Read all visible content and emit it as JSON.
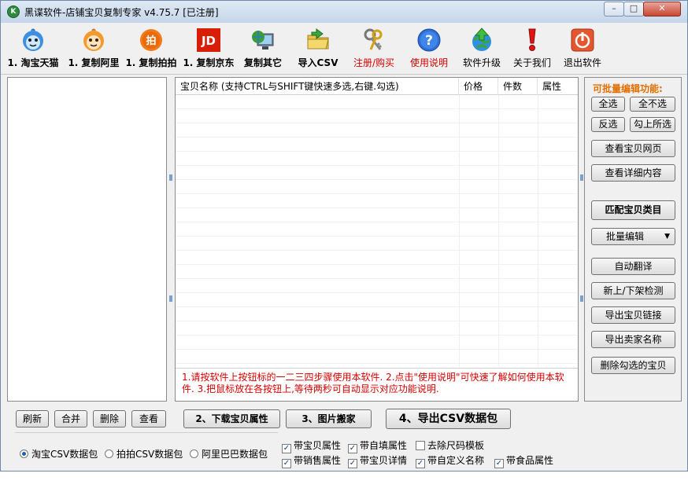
{
  "window": {
    "title": "黑谍软件-店铺宝贝复制专家  v4.75.7 [已注册]",
    "controls": {
      "minimize": "–",
      "maximize": "□",
      "close": "✕"
    }
  },
  "toolbar": [
    {
      "label": "1. 淘宝天猫",
      "icon": "taobao-mascot-icon",
      "style": "bold"
    },
    {
      "label": "1. 复制阿里",
      "icon": "ali-mascot-icon",
      "style": "bold"
    },
    {
      "label": "1. 复制拍拍",
      "icon": "paipai-icon",
      "icon_text": "拍",
      "style": "bold"
    },
    {
      "label": "1. 复制京东",
      "icon": "jd-icon",
      "icon_text": "JD",
      "style": "bold"
    },
    {
      "label": "复制其它",
      "icon": "computer-globe-icon",
      "style": "bold"
    },
    {
      "label": "导入CSV",
      "icon": "folder-import-icon",
      "style": "bold"
    },
    {
      "label": "注册/购买",
      "icon": "keys-icon",
      "style": "red"
    },
    {
      "label": "使用说明",
      "icon": "help-icon",
      "style": "red"
    },
    {
      "label": "软件升级",
      "icon": "upgrade-globe-icon",
      "style": "plain"
    },
    {
      "label": "关于我们",
      "icon": "exclamation-icon",
      "style": "plain"
    },
    {
      "label": "退出软件",
      "icon": "power-icon",
      "style": "plain"
    }
  ],
  "list": {
    "columns": [
      "宝贝名称 (支持CTRL与SHIFT键快速多选,右键.勾选)",
      "价格",
      "件数",
      "属性"
    ],
    "rows": []
  },
  "note": "1.请按软件上按钮标的一二三四步骤使用本软件. 2.点击\"使用说明\"可快速了解如何使用本软件. 3.把鼠标放在各按钮上,等待两秒可自动显示对应功能说明.",
  "right_panel": {
    "title": "可批量编辑功能:",
    "select_all": "全选",
    "select_none": "全不选",
    "invert": "反选",
    "check_selected": "勾上所选",
    "view_page": "查看宝贝网页",
    "view_detail": "查看详细内容",
    "match_category": "匹配宝贝类目",
    "batch_edit": "批量编辑",
    "auto_translate": "自动翻译",
    "shelf_check": "新上/下架检测",
    "export_links": "导出宝贝链接",
    "export_sellers": "导出卖家名称",
    "delete_checked": "删除勾选的宝贝"
  },
  "bottom": {
    "refresh": "刷新",
    "merge": "合并",
    "delete": "删除",
    "view": "查看",
    "step2": "2、下载宝贝属性",
    "step3": "3、图片搬家",
    "step4": "4、导出CSV数据包",
    "radios": [
      {
        "label": "淘宝CSV数据包",
        "checked": true
      },
      {
        "label": "拍拍CSV数据包",
        "checked": false
      },
      {
        "label": "阿里巴巴数据包",
        "checked": false
      }
    ],
    "checks": [
      {
        "label": "带宝贝属性",
        "checked": true
      },
      {
        "label": "带自填属性",
        "checked": true
      },
      {
        "label": "去除尺码模板",
        "checked": false
      },
      {
        "label": "带销售属性",
        "checked": true
      },
      {
        "label": "带宝贝详情",
        "checked": true
      },
      {
        "label": "带自定义名称",
        "checked": true
      },
      {
        "label": "带食品属性",
        "checked": true
      }
    ]
  }
}
